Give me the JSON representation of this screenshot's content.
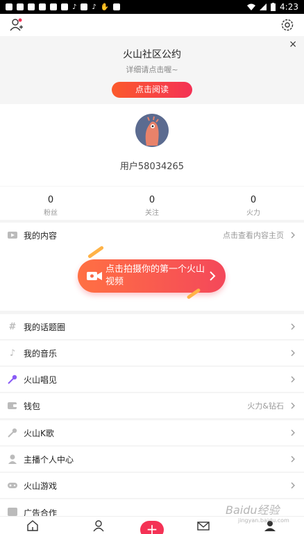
{
  "status_bar": {
    "time": "4:23"
  },
  "banner": {
    "title": "火山社区公约",
    "subtitle": "详细请点击喔~",
    "button": "点击阅读",
    "close": "×"
  },
  "profile": {
    "username": "用户58034265"
  },
  "stats": [
    {
      "value": "0",
      "label": "粉丝"
    },
    {
      "value": "0",
      "label": "关注"
    },
    {
      "value": "0",
      "label": "火力"
    }
  ],
  "my_content": {
    "label": "我的内容",
    "right_text": "点击查看内容主页",
    "shoot_button": "点击拍摄你的第一个火山视频"
  },
  "menu": [
    {
      "label": "我的话题圈",
      "right_text": "",
      "icon": "hash-icon"
    },
    {
      "label": "我的音乐",
      "right_text": "",
      "icon": "music-note-icon"
    },
    {
      "label": "火山唱见",
      "right_text": "",
      "icon": "microphone-icon"
    },
    {
      "label": "钱包",
      "right_text": "火力&钻石",
      "icon": "wallet-icon"
    },
    {
      "label": "火山K歌",
      "right_text": "",
      "icon": "karaoke-mic-icon"
    },
    {
      "label": "主播个人中心",
      "right_text": "",
      "icon": "person-icon"
    },
    {
      "label": "火山游戏",
      "right_text": "",
      "icon": "gamepad-icon"
    },
    {
      "label": "广告合作",
      "right_text": "",
      "icon": "ad-icon"
    }
  ],
  "bottom_nav": {
    "plus": "+"
  },
  "watermark": {
    "main": "Baidu经验",
    "sub": "jingyan.baidu.com"
  },
  "colors": {
    "accent": "#f43255",
    "accent_orange": "#fb5a2c"
  }
}
